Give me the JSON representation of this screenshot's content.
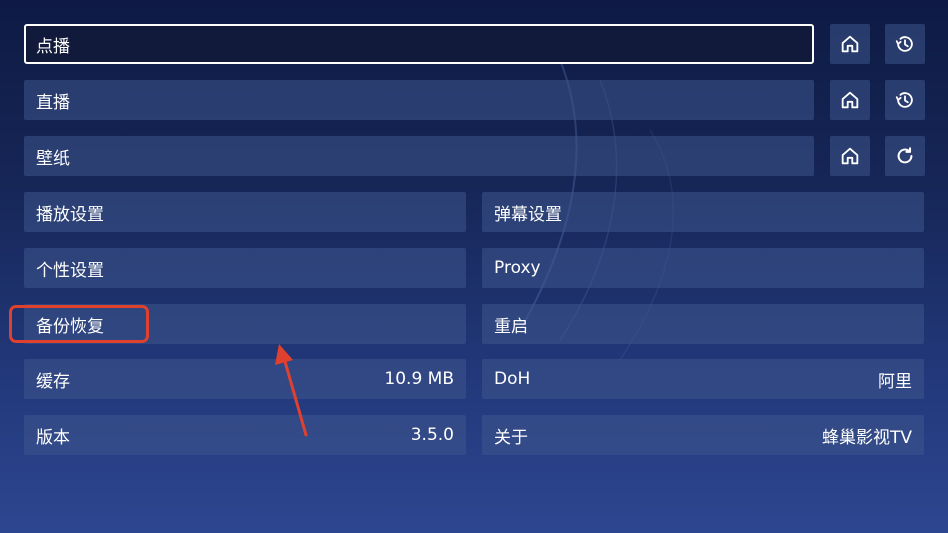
{
  "settings": {
    "vod": {
      "label": "点播"
    },
    "live": {
      "label": "直播"
    },
    "wallpaper": {
      "label": "壁纸"
    },
    "playback": {
      "label": "播放设置"
    },
    "danmaku": {
      "label": "弹幕设置"
    },
    "personal": {
      "label": "个性设置"
    },
    "proxy": {
      "label": "Proxy"
    },
    "backup": {
      "label": "备份恢复"
    },
    "restart": {
      "label": "重启"
    },
    "cache": {
      "label": "缓存",
      "value": "10.9 MB"
    },
    "doh": {
      "label": "DoH",
      "value": "阿里"
    },
    "version": {
      "label": "版本",
      "value": "3.5.0"
    },
    "about": {
      "label": "关于",
      "value": "蜂巢影视TV"
    }
  },
  "icons": {
    "home": "home-icon",
    "history": "history-icon",
    "refresh": "refresh-icon"
  },
  "colors": {
    "annotation": "#e0402e",
    "focus_border": "#ffffff"
  }
}
